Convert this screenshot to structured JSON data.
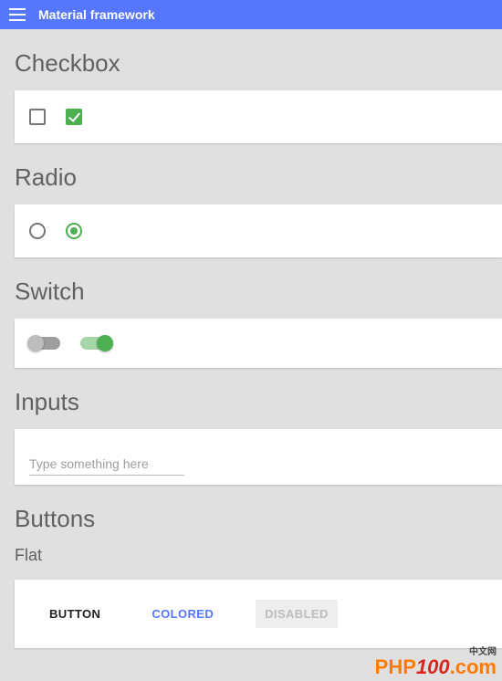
{
  "appbar": {
    "title": "Material framework"
  },
  "sections": {
    "checkbox": {
      "title": "Checkbox"
    },
    "radio": {
      "title": "Radio"
    },
    "switch": {
      "title": "Switch"
    },
    "inputs": {
      "title": "Inputs",
      "placeholder": "Type something here"
    },
    "buttons": {
      "title": "Buttons",
      "flat_label": "Flat",
      "flat": {
        "default": "BUTTON",
        "colored": "COLORED",
        "disabled": "DISABLED"
      }
    }
  },
  "watermark": {
    "small": "中文网",
    "php": "PHP",
    "num": "100",
    "com": ".com"
  }
}
